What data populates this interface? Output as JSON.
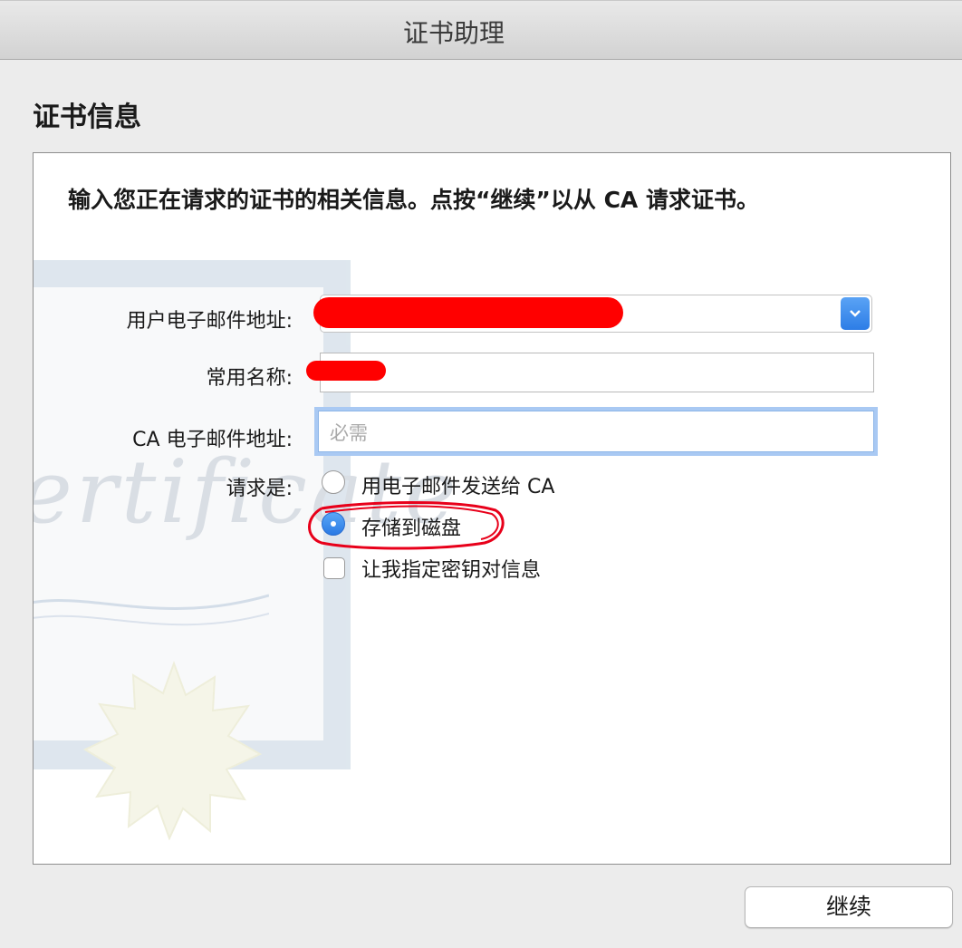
{
  "window": {
    "title": "证书助理"
  },
  "section_title": "证书信息",
  "intro": "输入您正在请求的证书的相关信息。点按“继续”以从 CA 请求证书。",
  "watermark_text": "ertificate",
  "form": {
    "email_label": "用户电子邮件地址:",
    "common_name_label": "常用名称:",
    "ca_email_label": "CA 电子邮件地址:",
    "ca_email_placeholder": "必需",
    "request_label": "请求是:",
    "options": [
      {
        "label": "用电子邮件发送给 CA",
        "checked": false
      },
      {
        "label": "存储到磁盘",
        "checked": true
      }
    ],
    "checkbox": {
      "label": "让我指定密钥对信息",
      "checked": false
    }
  },
  "continue_label": "继续",
  "colors": {
    "accent": "#2d7de6",
    "redaction": "#ff0000",
    "focus_ring": "#a9c9f3"
  }
}
